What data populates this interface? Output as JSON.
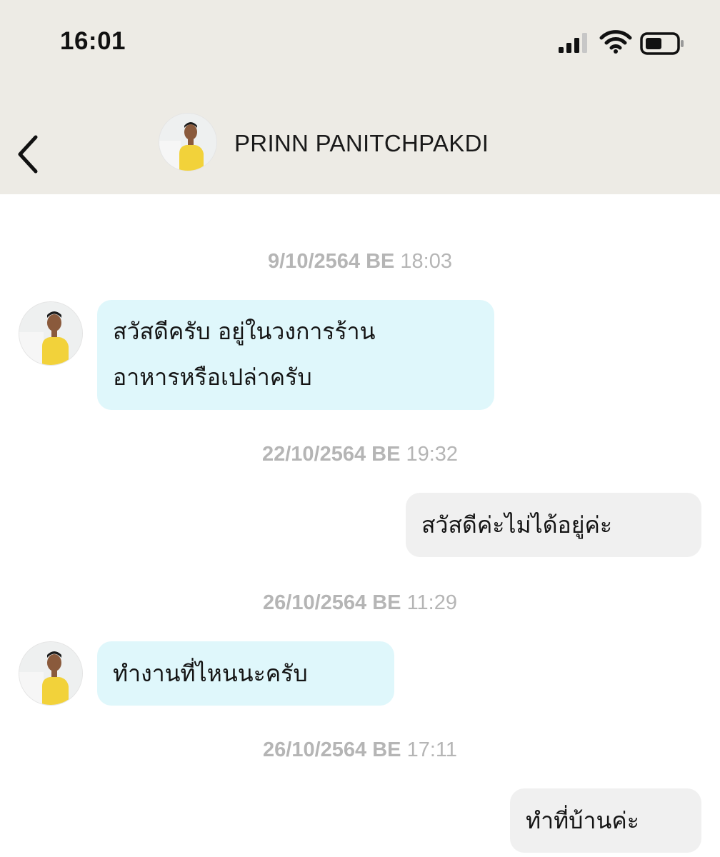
{
  "status_bar": {
    "time": "16:01",
    "icons": [
      "cellular-signal-icon",
      "wifi-icon",
      "battery-icon"
    ]
  },
  "header": {
    "back_icon": "chevron-left-icon",
    "contact_name": "PRINN PANITCHPAKDI",
    "avatar": "contact-avatar"
  },
  "messages": [
    {
      "date": "9/10/2564 BE",
      "time": "18:03",
      "direction": "incoming",
      "lines": [
        "สวัสดีครับ อยู่ในวงการร้าน",
        "อาหารหรือเปล่าครับ"
      ]
    },
    {
      "date": "22/10/2564 BE",
      "time": "19:32",
      "direction": "outgoing",
      "lines": [
        "สวัสดีค่ะไม่ได้อยู่ค่ะ"
      ]
    },
    {
      "date": "26/10/2564 BE",
      "time": "11:29",
      "direction": "incoming",
      "lines": [
        "ทำงานที่ไหนนะครับ"
      ]
    },
    {
      "date": "26/10/2564 BE",
      "time": "17:11",
      "direction": "outgoing",
      "lines": [
        "ทำที่บ้านค่ะ"
      ]
    }
  ],
  "colors": {
    "header_bg": "#edebe5",
    "incoming_bubble": "#dff7fb",
    "outgoing_bubble": "#f0f0f0",
    "timestamp_text": "#b5b5b5",
    "avatar_shirt": "#f2d23a"
  }
}
